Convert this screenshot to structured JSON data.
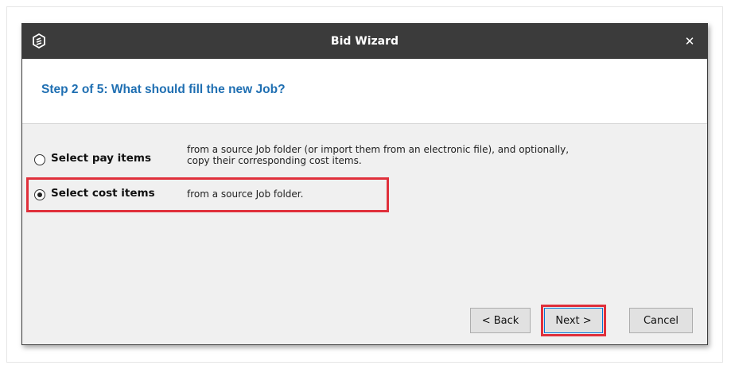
{
  "dialog": {
    "title": "Bid Wizard",
    "app_icon": "app-logo-icon",
    "close_icon": "close-icon",
    "close_glyph": "✕"
  },
  "header": {
    "step_title": "Step 2 of 5: What should fill the new Job?"
  },
  "options": [
    {
      "label": "Select pay items",
      "description_line1": "from a source Job folder (or import them from an electronic file), and optionally,",
      "description_line2": "copy their corresponding cost items.",
      "selected": false
    },
    {
      "label": "Select cost items",
      "description_line1": "from a source Job folder.",
      "selected": true
    }
  ],
  "buttons": {
    "back": "< Back",
    "next": "Next >",
    "cancel": "Cancel"
  },
  "colors": {
    "titlebar": "#3b3b3b",
    "step_title": "#1f6fb2",
    "highlight": "#e0303b"
  }
}
